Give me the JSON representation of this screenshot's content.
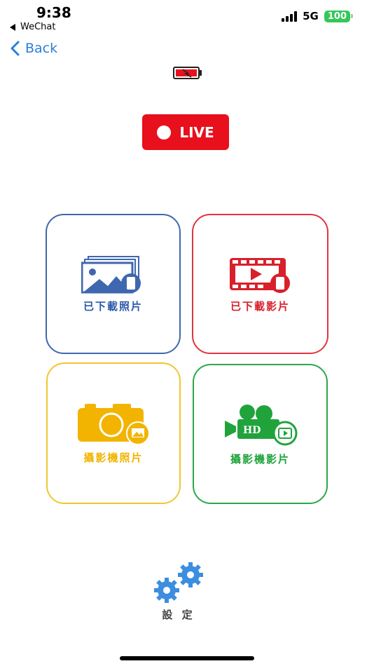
{
  "status_bar": {
    "time": "9:38",
    "back_app": "WeChat",
    "network": "5G",
    "battery": "100"
  },
  "nav": {
    "back_label": "Back"
  },
  "live": {
    "label": "LIVE",
    "color": "#e8101c"
  },
  "tiles": [
    {
      "label": "已下載照片",
      "icon": "photo-gallery-icon",
      "color": "#3f67b0"
    },
    {
      "label": "已下載影片",
      "icon": "film-strip-play-icon",
      "color": "#e0343f"
    },
    {
      "label": "攝影機照片",
      "icon": "camera-icon",
      "color": "#f2b400"
    },
    {
      "label": "攝影機影片",
      "icon": "video-camera-hd-icon",
      "color": "#21a33c"
    }
  ],
  "settings": {
    "label": "設 定",
    "icon": "gears-icon",
    "color": "#3b8ee0"
  }
}
